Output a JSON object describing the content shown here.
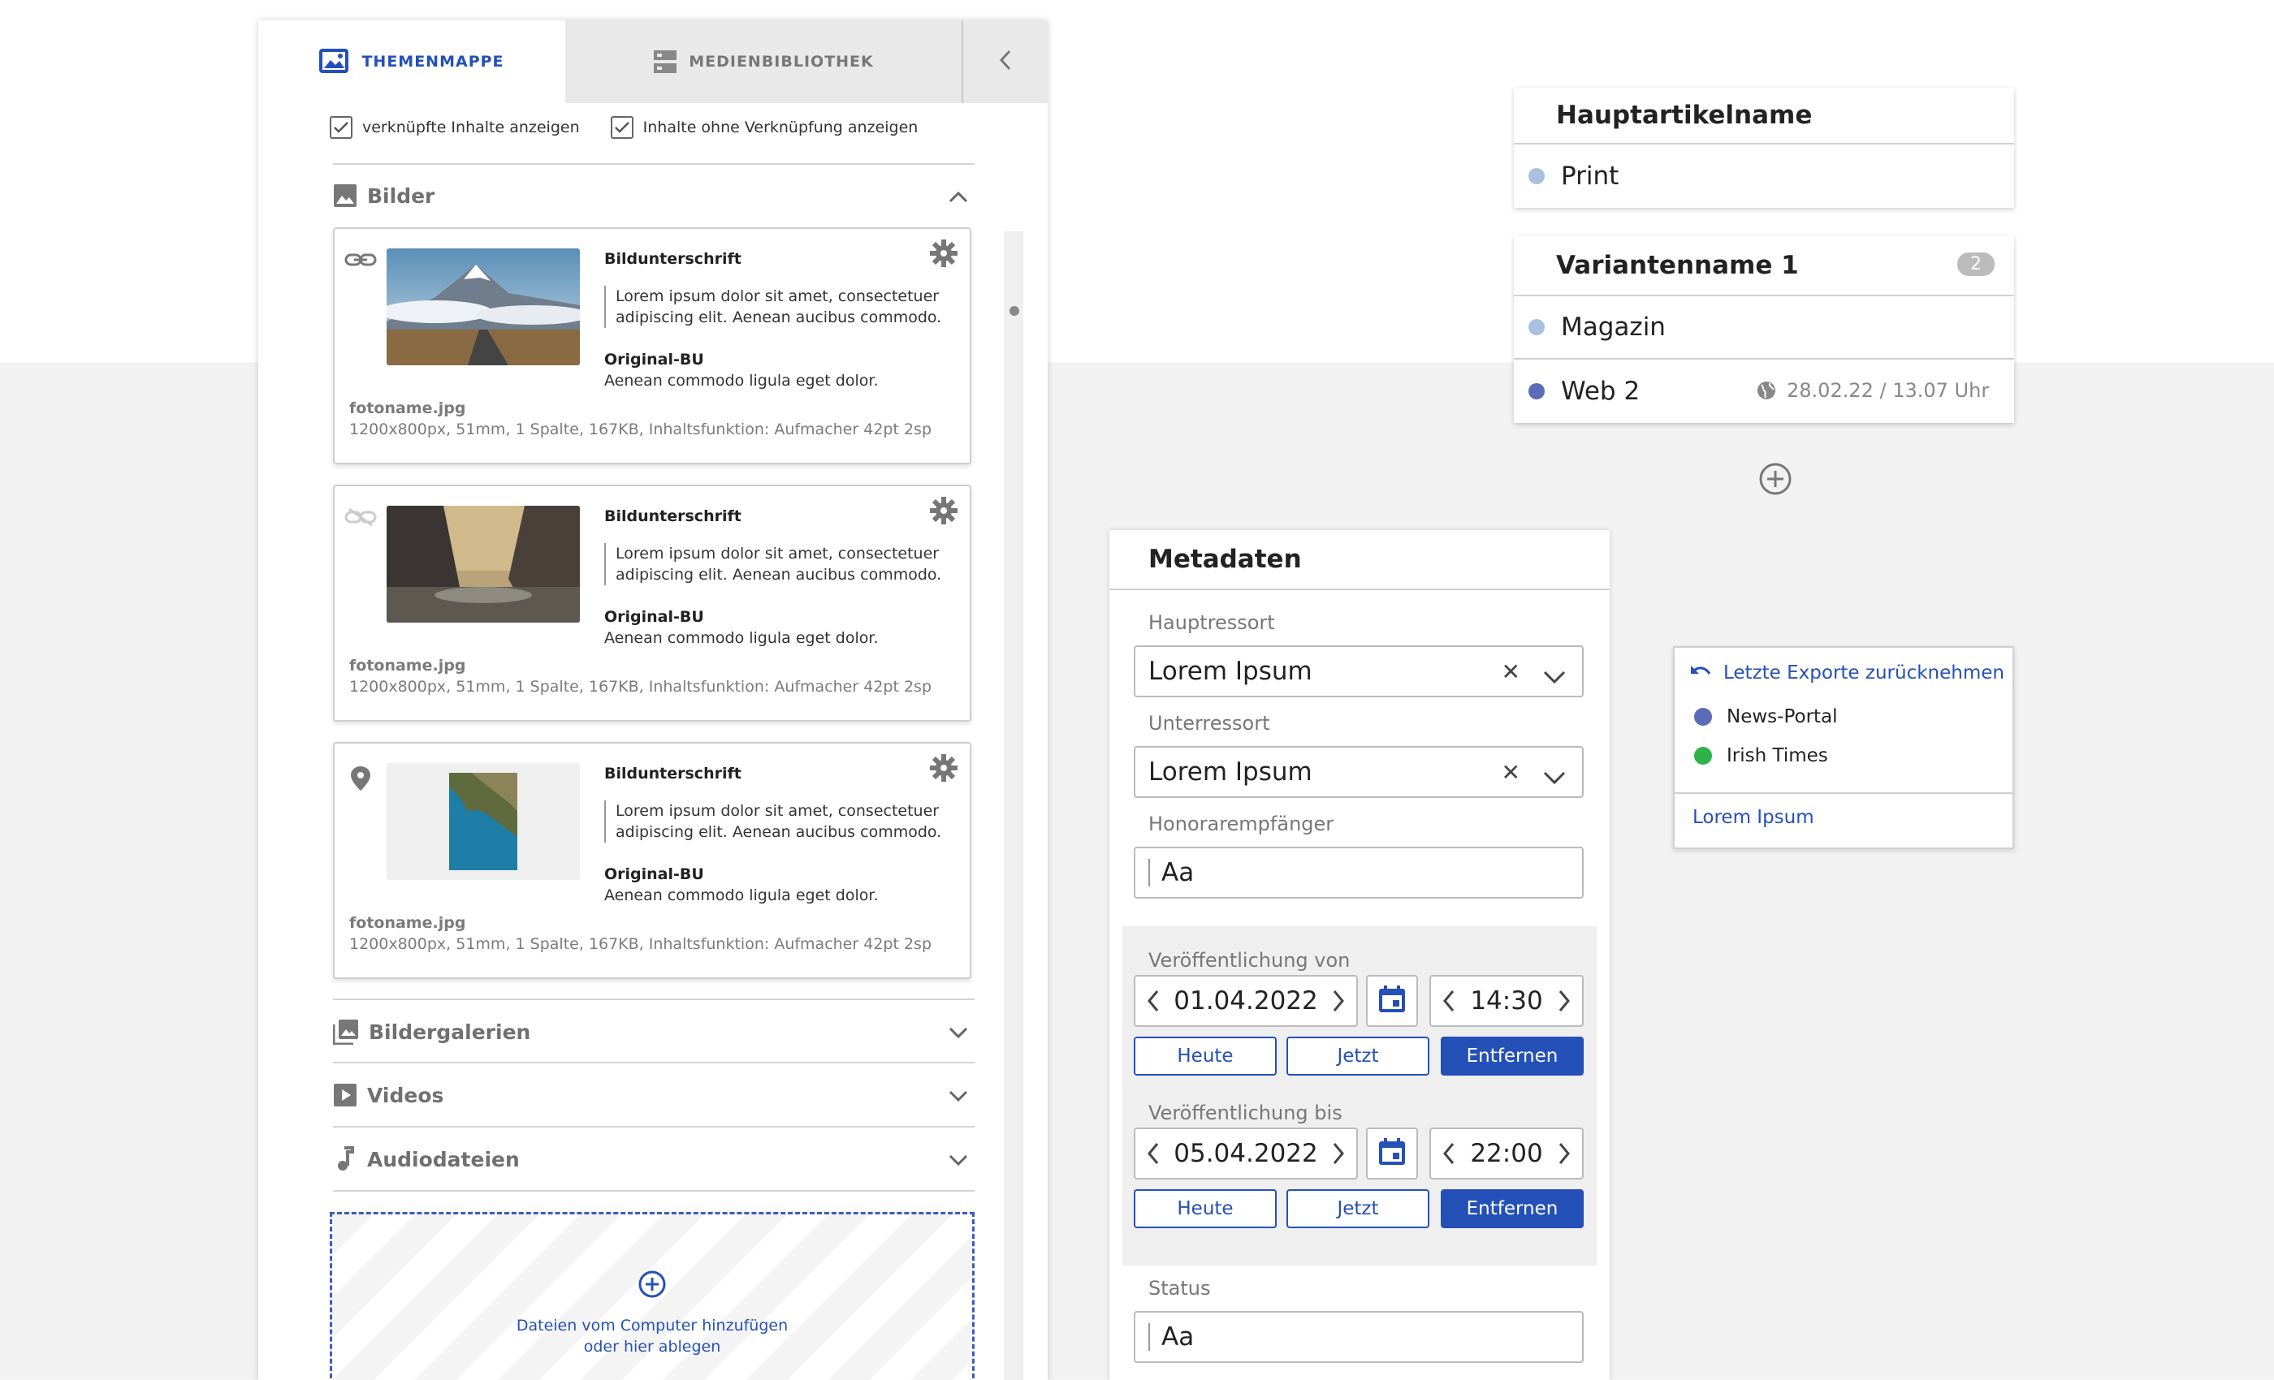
{
  "left_panel": {
    "tabs": {
      "active": "THEMENMAPPE",
      "inactive": "MEDIENBIBLIOTHEK"
    },
    "filters": {
      "linked": "verknüpfte Inhalte anzeigen",
      "unlinked": "Inhalte ohne Verknüpfung anzeigen"
    },
    "sections": {
      "images": "Bilder",
      "galleries": "Bildergalerien",
      "videos": "Videos",
      "audio": "Audiodateien"
    },
    "cards": [
      {
        "caption_title": "Bildunterschrift",
        "caption_text": "Lorem ipsum dolor sit amet, consectetuer adipiscing elit. Aenean aucibus commodo.",
        "orig_title": "Original-BU",
        "orig_text": "Aenean commodo ligula eget dolor.",
        "filename": "fotoname.jpg",
        "meta": "1200x800px, 51mm, 1 Spalte, 167KB, Inhaltsfunktion: Aufmacher 42pt 2sp",
        "status_icon": "link-icon"
      },
      {
        "caption_title": "Bildunterschrift",
        "caption_text": "Lorem ipsum dolor sit amet, consectetuer adipiscing elit. Aenean aucibus commodo.",
        "orig_title": "Original-BU",
        "orig_text": "Aenean commodo ligula eget dolor.",
        "filename": "fotoname.jpg",
        "meta": "1200x800px, 51mm, 1 Spalte, 167KB, Inhaltsfunktion: Aufmacher 42pt 2sp",
        "status_icon": "link-off-icon"
      },
      {
        "caption_title": "Bildunterschrift",
        "caption_text": "Lorem ipsum dolor sit amet, consectetuer adipiscing elit. Aenean aucibus commodo.",
        "orig_title": "Original-BU",
        "orig_text": "Aenean commodo ligula eget dolor.",
        "filename": "fotoname.jpg",
        "meta": "1200x800px, 51mm, 1 Spalte, 167KB, Inhaltsfunktion: Aufmacher 42pt 2sp",
        "status_icon": "location-pin-icon"
      }
    ],
    "dropzone": {
      "line1": "Dateien vom Computer hinzufügen",
      "line2": "oder hier ablegen"
    }
  },
  "variants": {
    "main": {
      "title": "Hauptartikelname",
      "rows": [
        {
          "label": "Print",
          "color": "#a9c1de"
        }
      ]
    },
    "variant1": {
      "title": "Variantenname 1",
      "badge": "2",
      "rows": [
        {
          "label": "Magazin",
          "color": "#a9c1de"
        },
        {
          "label": "Web 2",
          "color": "#5b6bb8",
          "date": "28.02.22 / 13.07 Uhr"
        }
      ]
    }
  },
  "export_menu": {
    "undo_label": "Letzte Exporte zurücknehmen",
    "items": [
      {
        "label": "News-Portal",
        "color": "#5b6bb8"
      },
      {
        "label": "Irish Times",
        "color": "#2db34a"
      }
    ],
    "footer_link": "Lorem Ipsum"
  },
  "metadata": {
    "title": "Metadaten",
    "hauptressort": {
      "label": "Hauptressort",
      "value": "Lorem Ipsum"
    },
    "unterressort": {
      "label": "Unterressort",
      "value": "Lorem Ipsum"
    },
    "honorar": {
      "label": "Honorarempfänger",
      "value": "Aa"
    },
    "pub_from": {
      "label": "Veröffentlichung von",
      "date": "01.04.2022",
      "time": "14:30"
    },
    "pub_to": {
      "label": "Veröffentlichung bis",
      "date": "05.04.2022",
      "time": "22:00"
    },
    "buttons": {
      "today": "Heute",
      "now": "Jetzt",
      "remove": "Entfernen"
    },
    "status": {
      "label": "Status",
      "value": "Aa"
    }
  },
  "colors": {
    "accent": "#2450b8",
    "divider": "#d4d4d4"
  }
}
